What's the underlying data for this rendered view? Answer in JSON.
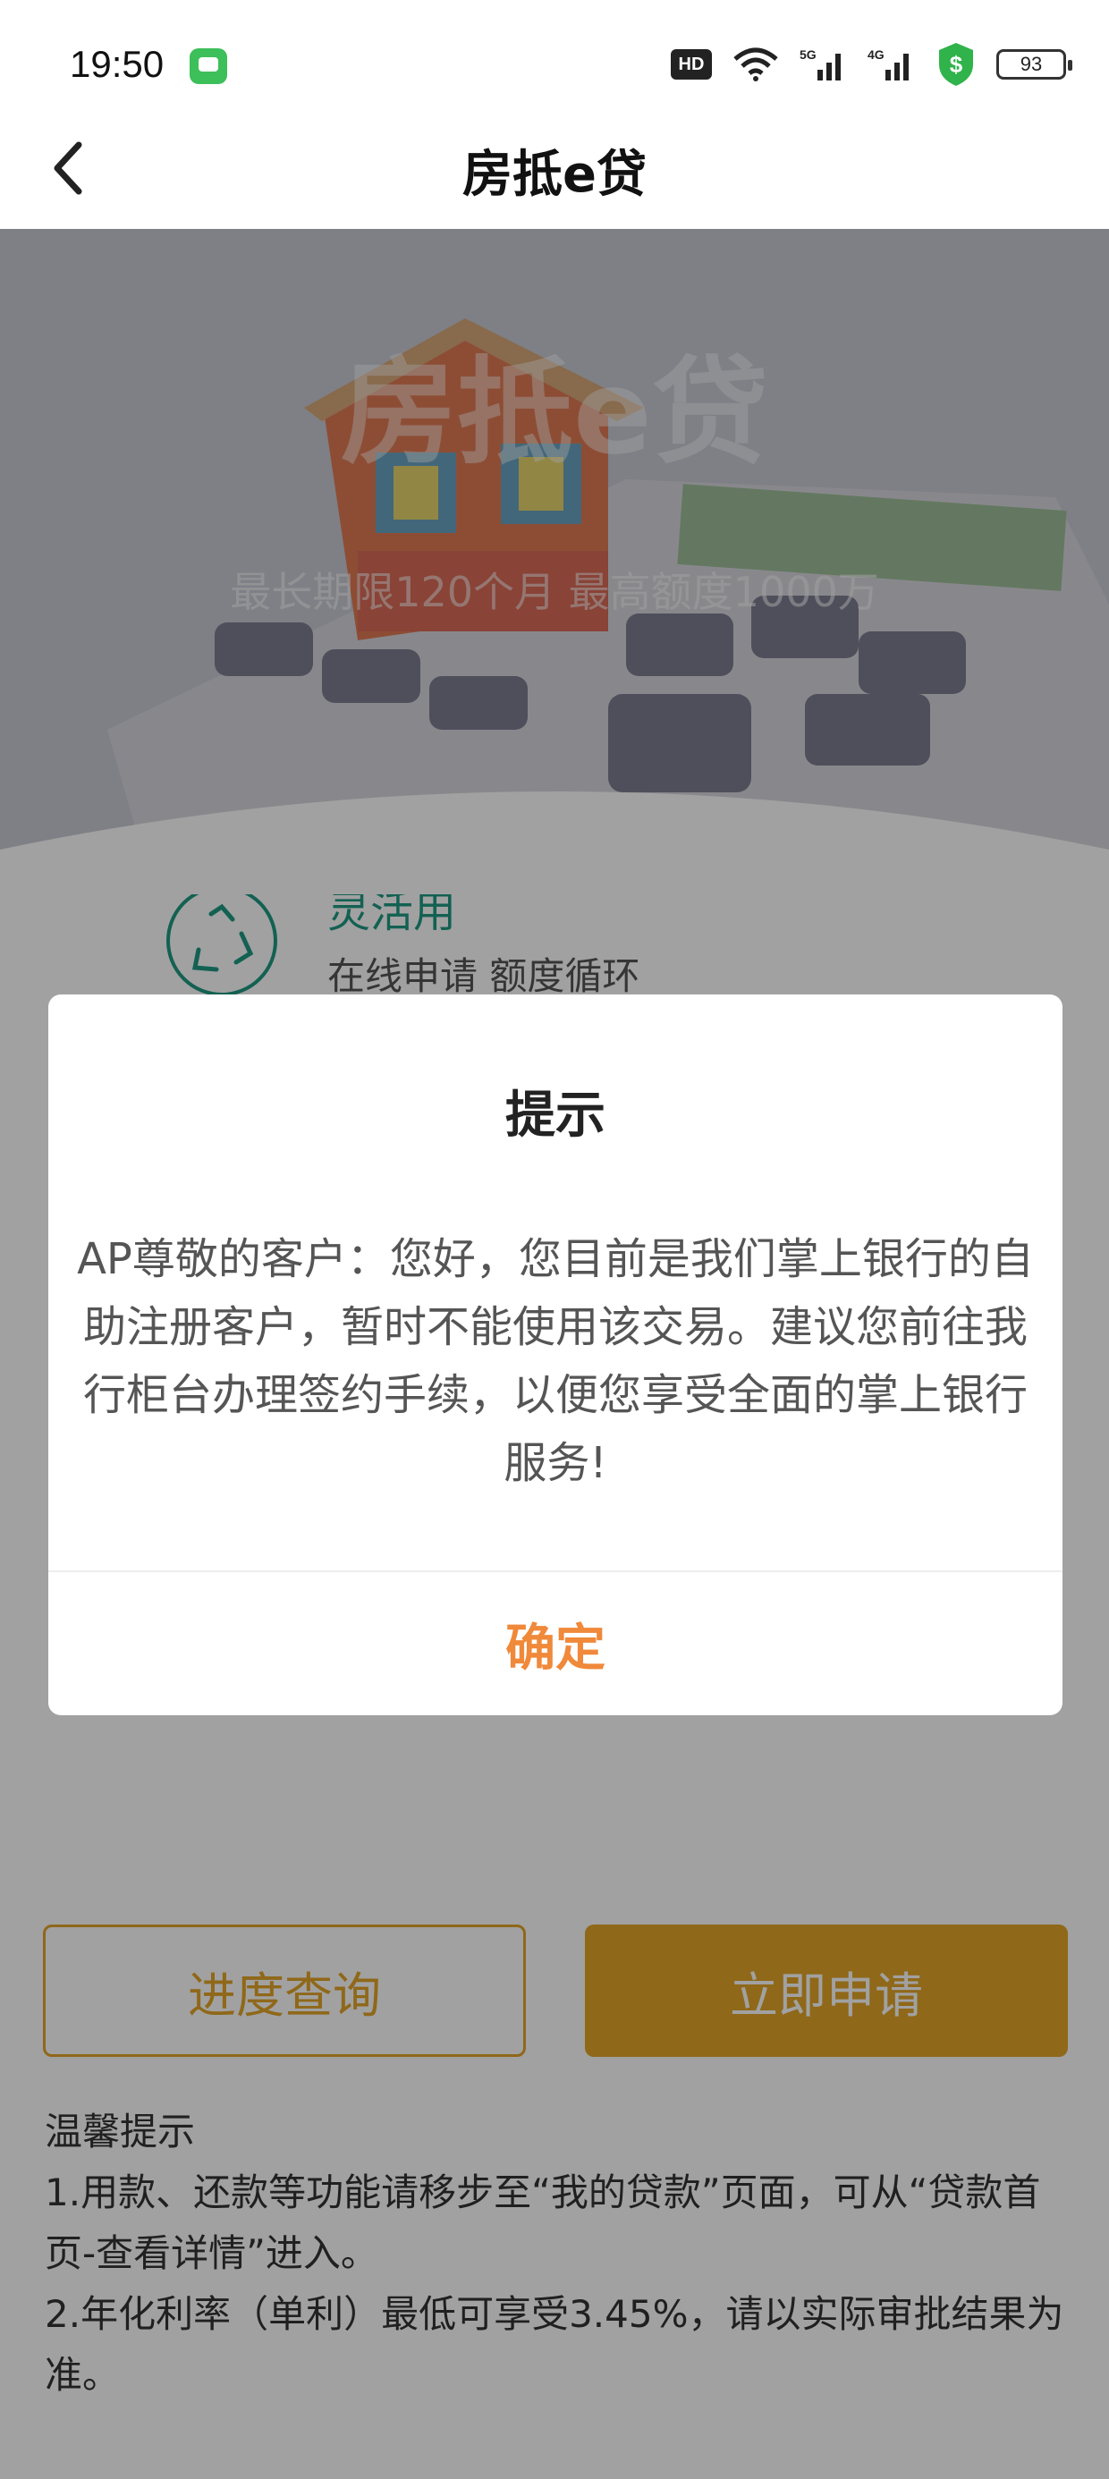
{
  "status_bar": {
    "time": "19:50",
    "hd_label": "HD",
    "battery": "93",
    "icons": [
      "message-icon",
      "hd-icon",
      "wifi-icon",
      "5g-signal-icon",
      "4g-signal-icon",
      "shield-icon",
      "battery-icon"
    ]
  },
  "nav": {
    "title": "房抵e贷",
    "back_icon": "chevron-left-icon"
  },
  "hero": {
    "title": "房抵e贷",
    "subtitle": "最长期限120个月 最高额度1000万"
  },
  "feature": {
    "title": "灵活用",
    "desc": "在线申请 额度循环",
    "icon": "recycle-icon"
  },
  "dialog": {
    "title": "提示",
    "message": "AP尊敬的客户：您好，您目前是我们掌上银行的自助注册客户，暂时不能使用该交易。建议您前往我行柜台办理签约手续，以便您享受全面的掌上银行服务!",
    "ok_label": "确定"
  },
  "actions": {
    "progress_label": "进度查询",
    "apply_label": "立即申请"
  },
  "tips": {
    "heading": "温馨提示",
    "items": [
      "1.用款、还款等功能请移步至“我的贷款”页面，可从“贷款首页-查看详情”进入。",
      "2.年化利率（单利）最低可享受3.45%，请以实际审批结果为准。"
    ]
  },
  "colors": {
    "accent": "#e3a528",
    "feature_green": "#1f9a82",
    "ok_orange": "#f0893a"
  }
}
